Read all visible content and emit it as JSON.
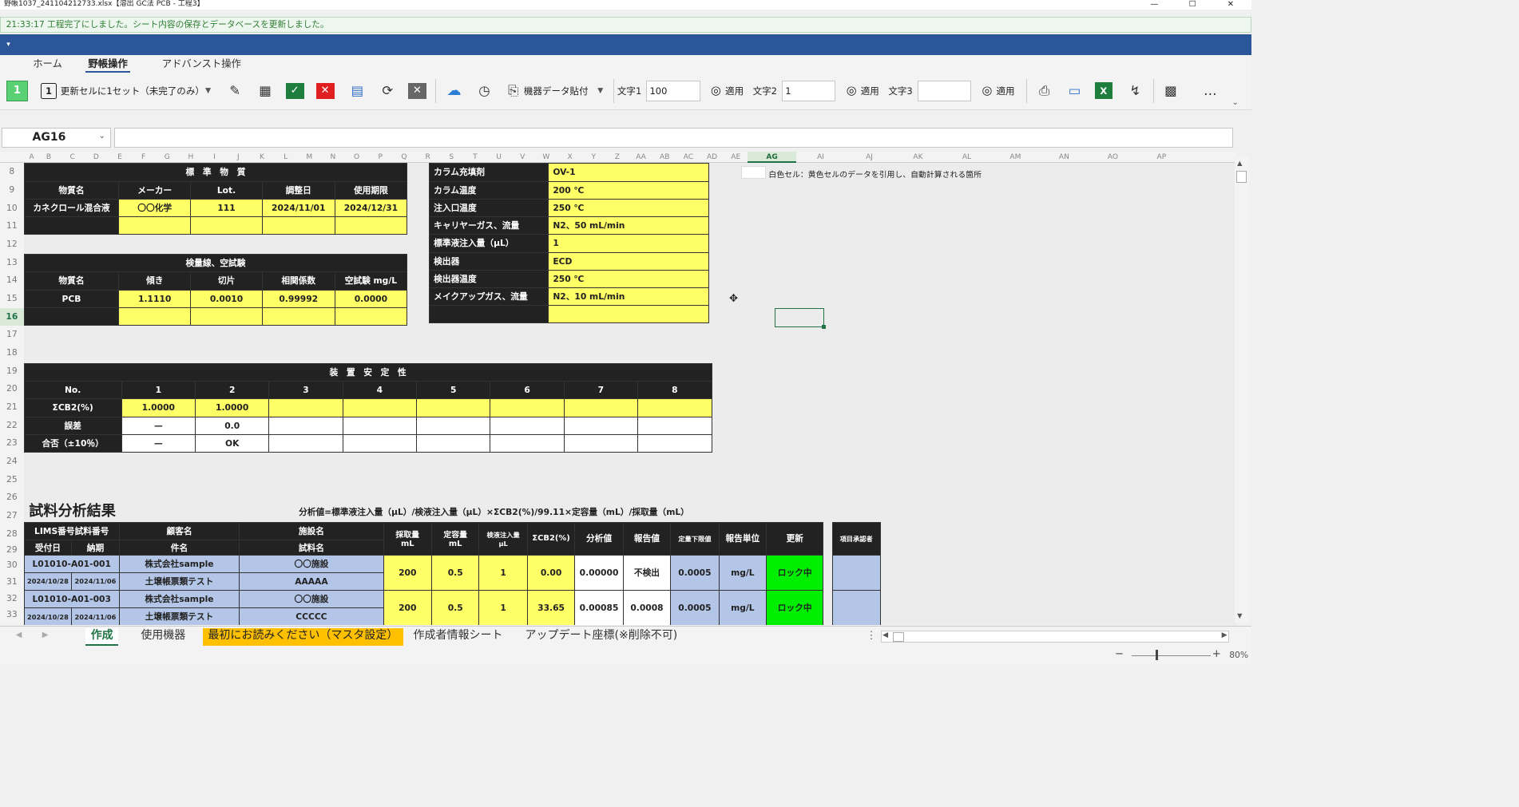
{
  "window": {
    "title": "野帳1037_241104212733.xlsx【溶出 GC法 PCB - 工程3】",
    "min": "—",
    "max": "☐",
    "close": "✕"
  },
  "status": "21:33:17 工程完了にしました。シート内容の保存とデータベースを更新しました。",
  "band": {
    "qat": "▾"
  },
  "tabs": [
    "ホーム",
    "野帳操作",
    "アドバンスト操作"
  ],
  "toolbar": {
    "step_badge": "1",
    "update_badge": "1",
    "update_label": "更新セルに1セット（未完了のみ）",
    "device_paste": "機器データ貼付",
    "text1_label": "文字1",
    "text1_value": "100",
    "text2_label": "文字2",
    "text2_value": "1",
    "text3_label": "文字3",
    "text3_value": "",
    "apply": "適用",
    "more": "…"
  },
  "namebox": "AG16",
  "colors": {
    "accent": "#217346",
    "ribbon": "#2b579a",
    "yellow": "#ffff66",
    "header": "#222222",
    "blue": "#b4c6e7",
    "green": "#00ee00"
  },
  "cols": [
    "A",
    "B",
    "C",
    "D",
    "E",
    "F",
    "G",
    "H",
    "I",
    "J",
    "K",
    "L",
    "M",
    "N",
    "O",
    "P",
    "Q",
    "R",
    "S",
    "T",
    "U",
    "V",
    "W",
    "X",
    "Y",
    "Z",
    "AA",
    "AB",
    "AC",
    "AD",
    "AE",
    "AG",
    "AI",
    "AJ",
    "AK",
    "AL",
    "AM",
    "AN",
    "AO",
    "AP"
  ],
  "rows": [
    "8",
    "9",
    "10",
    "11",
    "12",
    "13",
    "14",
    "15",
    "16",
    "17",
    "18",
    "19",
    "20",
    "21",
    "22",
    "23",
    "24",
    "25",
    "26",
    "27",
    "28",
    "29",
    "30",
    "31",
    "32",
    "33"
  ],
  "std": {
    "title": "標　準　物　質",
    "headers": [
      "物質名",
      "メーカー",
      "Lot.",
      "調整日",
      "使用期限"
    ],
    "row1": [
      "カネクロール混合液",
      "〇〇化学",
      "111",
      "2024/11/01",
      "2024/12/31"
    ]
  },
  "cal": {
    "title": "検量線、空試験",
    "headers": [
      "物質名",
      "傾き",
      "切片",
      "相関係数",
      "空試験 mg/L"
    ],
    "row1": [
      "PCB",
      "1.1110",
      "0.0010",
      "0.99992",
      "0.0000"
    ]
  },
  "cond": [
    {
      "k": "カラム充填剤",
      "v": "OV-1"
    },
    {
      "k": "カラム温度",
      "v": "200 ℃"
    },
    {
      "k": "注入口温度",
      "v": "250 ℃"
    },
    {
      "k": "キャリヤーガス、流量",
      "v": "N2、50 mL/min"
    },
    {
      "k": "標準液注入量（μL）",
      "v": "1"
    },
    {
      "k": "検出器",
      "v": "ECD"
    },
    {
      "k": "検出器温度",
      "v": "250 ℃"
    },
    {
      "k": "メイクアップガス、流量",
      "v": "N2、10 mL/min"
    }
  ],
  "legend_note": "白色セル：黄色セルのデータを引用し、自動計算される箇所",
  "stab": {
    "title": "装　置　安　定　性",
    "no_label": "No.",
    "nums": [
      "1",
      "2",
      "3",
      "4",
      "5",
      "6",
      "7",
      "8"
    ],
    "labels": [
      "ΣCB2(%)",
      "誤差",
      "合否（±10％）"
    ],
    "cb2": [
      "1.0000",
      "1.0000"
    ],
    "err": [
      "—",
      "0.0"
    ],
    "pass": [
      "—",
      "OK"
    ]
  },
  "results": {
    "title": "試料分析結果",
    "formula": "分析値=標準液注入量（μL）/検液注入量（μL）×ΣCB2(%)/99.11×定容量（mL）/採取量（mL）",
    "h1": {
      "lims": "LIMS番号試料番号",
      "customer": "顧客名",
      "facility": "施設名",
      "recv": "受付日",
      "due": "納期",
      "case": "件名",
      "sample": "試料名"
    },
    "cols": [
      "採取量\nmL",
      "定容量\nmL",
      "検液注入量\nμL",
      "ΣCB2(%)",
      "分析値",
      "報告値",
      "定量下限値",
      "報告単位",
      "更新"
    ],
    "approver": "項目承認者",
    "rows": [
      {
        "lims": "L01010-A01-001",
        "recv": "2024/10/28",
        "due": "2024/11/06",
        "customer": "株式会社sample",
        "case": "土壌帳票類テスト",
        "facility": "〇〇施設",
        "sample": "AAAAA",
        "vals": [
          "200",
          "0.5",
          "1",
          "0.00",
          "0.00000",
          "不検出",
          "0.0005",
          "mg/L",
          "ロック中"
        ]
      },
      {
        "lims": "L01010-A01-003",
        "recv": "2024/10/28",
        "due": "2024/11/06",
        "customer": "株式会社sample",
        "case": "土壌帳票類テスト",
        "facility": "〇〇施設",
        "sample": "CCCCC",
        "vals": [
          "200",
          "0.5",
          "1",
          "33.65",
          "0.00085",
          "0.0008",
          "0.0005",
          "mg/L",
          "ロック中"
        ]
      }
    ]
  },
  "sheet_tabs": [
    "作成",
    "使用機器",
    "最初にお読みください（マスタ設定）",
    "作成者情報シート",
    "アップデート座標(※削除不可)"
  ],
  "zoom": "80%"
}
